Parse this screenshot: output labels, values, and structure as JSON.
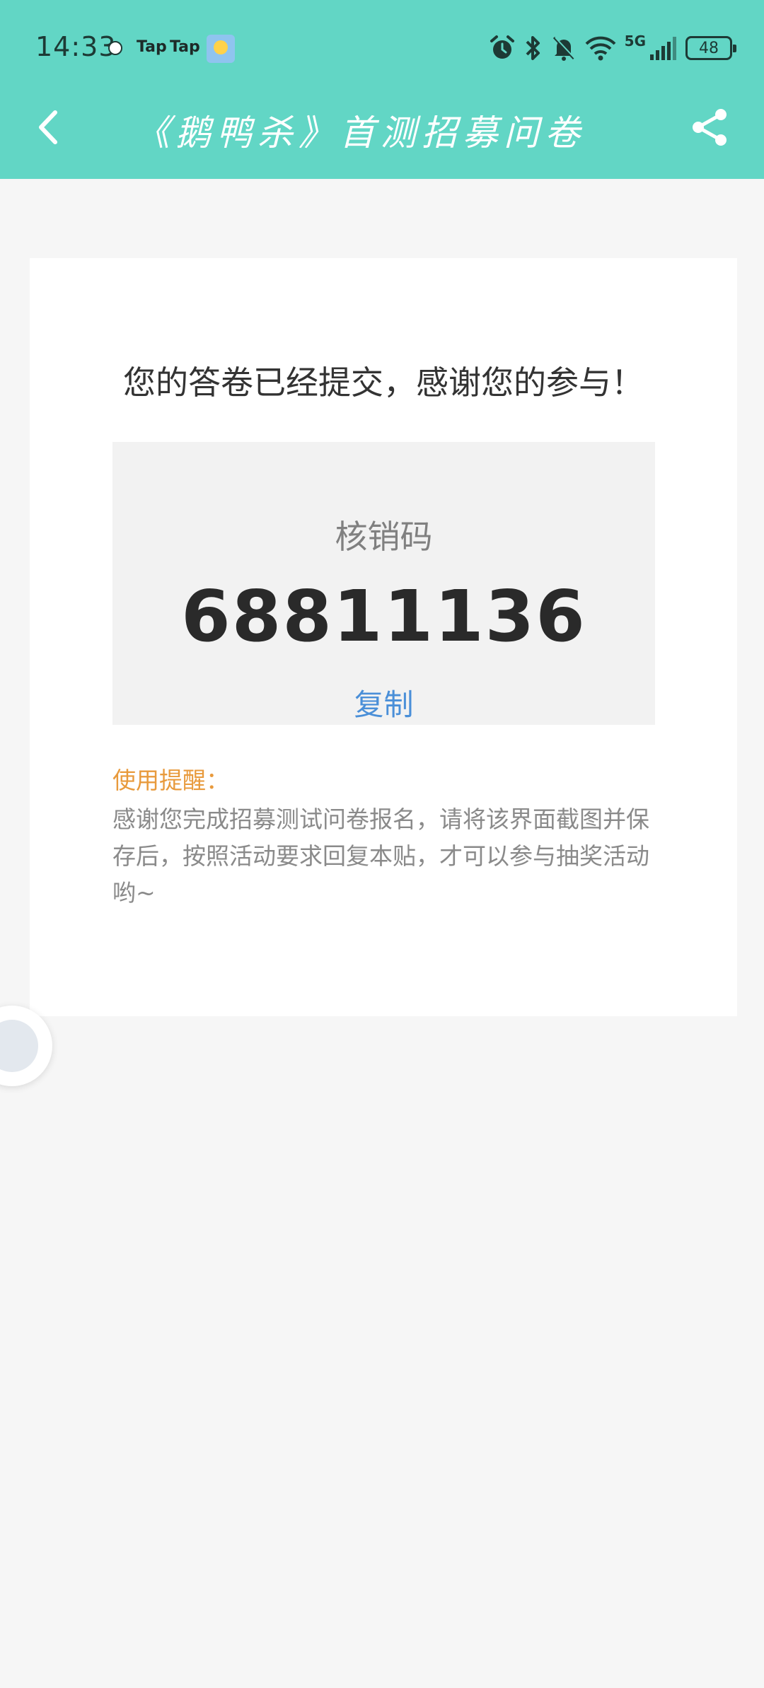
{
  "status_bar": {
    "time": "14:33",
    "app_badge_1": "Tap",
    "app_badge_2": "Tap",
    "battery": "48",
    "network": "5G"
  },
  "nav": {
    "title": "《鹅鸭杀》首测招募问卷"
  },
  "result": {
    "message": "您的答卷已经提交，感谢您的参与！",
    "code_label": "核销码",
    "code_value": "68811136",
    "copy_label": "复制"
  },
  "tip": {
    "title": "使用提醒：",
    "body": "感谢您完成招募测试问卷报名，请将该界面截图并保存后，按照活动要求回复本贴，才可以参与抽奖活动哟~"
  },
  "colors": {
    "header": "#62d6c5",
    "accent_blue": "#4a8fd8",
    "tip_orange": "#e89a3c"
  },
  "icons": {
    "back": "chevron-left-icon",
    "share": "share-icon",
    "alarm": "alarm-icon",
    "bluetooth": "bluetooth-icon",
    "mute": "bell-off-icon",
    "wifi": "wifi-icon",
    "signal": "signal-icon"
  }
}
